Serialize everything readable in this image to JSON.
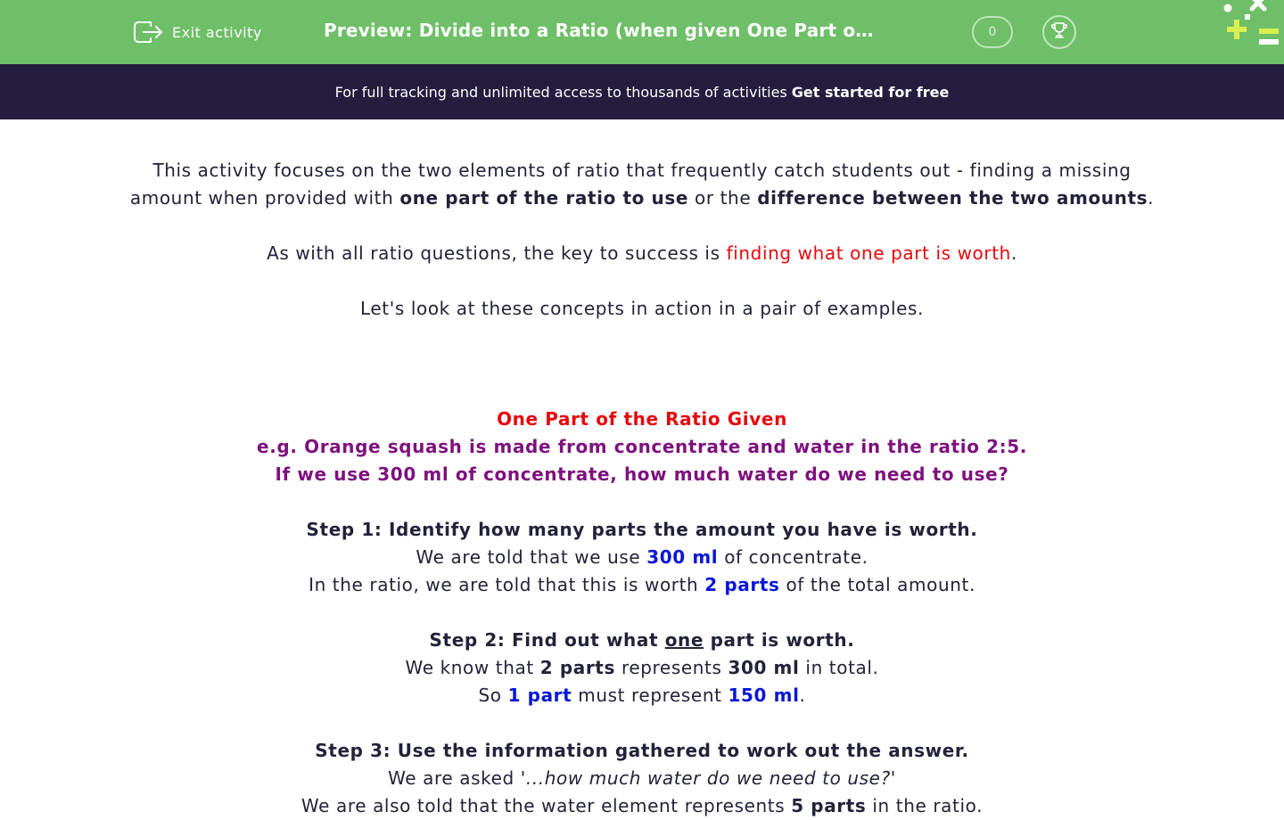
{
  "header": {
    "exit_label": "Exit activity",
    "title": "Preview: Divide into a Ratio (when given One Part or Differ...",
    "score": "0",
    "icons": [
      "exit-icon",
      "trophy-icon",
      "logo-icon"
    ]
  },
  "promo": {
    "text": "For full tracking and unlimited access to thousands of activities",
    "cta": "Get started for free"
  },
  "intro": {
    "p1_a": "This activity focuses on the two elements of ratio that frequently catch students out - finding a missing",
    "p1_b": "amount when provided with ",
    "p1_bold1": "one part of the ratio to use",
    "p1_c": " or the ",
    "p1_bold2": "difference between the two amounts",
    "p1_d": ".",
    "p2_a": "As with all ratio questions, the key to success is ",
    "p2_red": "finding what one part is worth",
    "p2_b": ".",
    "p3": "Let's look at these concepts in action in a pair of examples."
  },
  "example": {
    "heading": "One Part of the Ratio Given",
    "q1": "e.g. Orange squash is made from concentrate and water in the ratio 2:5.",
    "q2": "If we use 300 ml of concentrate, how much water do we need to use?",
    "step1": {
      "title": "Step 1: Identify how many parts the amount you have is worth.",
      "l1_a": "We are told that we use ",
      "l1_blue": "300 ml",
      "l1_b": " of concentrate.",
      "l2_a": "In the ratio, we are told that this is worth ",
      "l2_blue": "2 parts",
      "l2_b": " of the total amount."
    },
    "step2": {
      "title_a": "Step 2: Find out what ",
      "title_u": "one",
      "title_b": " part is worth.",
      "l1_a": "We know that ",
      "l1_b1": "2 parts",
      "l1_b": " represents ",
      "l1_b2": "300 ml",
      "l1_c": " in total.",
      "l2_a": "So ",
      "l2_blue1": "1 part",
      "l2_b": " must represent ",
      "l2_blue2": "150 ml",
      "l2_c": "."
    },
    "step3": {
      "title": "Step 3: Use the information gathered to work out the answer.",
      "l1_a": "We are asked ",
      "l1_i": "'...how much water do we need to use?'",
      "l2_a": "We are also told that the water element represents ",
      "l2_b": "5 parts",
      "l2_c": " in the ratio."
    }
  },
  "colors": {
    "header_green": "#6ebf67",
    "promo_navy": "#241d3e",
    "accent_red": "#e5080c",
    "accent_purple": "#7e117e",
    "accent_blue": "#0a17d4"
  }
}
